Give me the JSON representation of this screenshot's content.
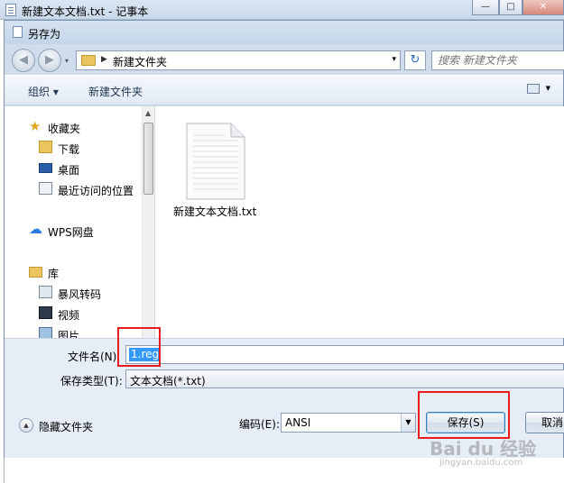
{
  "notepad": {
    "title": "新建文本文档.txt - 记事本",
    "minimize": "—",
    "maximize": "□",
    "close": "✕"
  },
  "dialog": {
    "title": "另存为",
    "nav": {
      "back": "◀",
      "forward": "▶",
      "path_current": "新建文件夹",
      "refresh": "↻",
      "search_placeholder": "搜索 新建文件夹"
    },
    "toolbar": {
      "organize": "组织 ▾",
      "new_folder": "新建文件夹"
    },
    "sidebar": {
      "favorites": "收藏夹",
      "items": [
        {
          "label": "下载",
          "icon": "download-folder-icon"
        },
        {
          "label": "桌面",
          "icon": "desktop-icon"
        },
        {
          "label": "最近访问的位置",
          "icon": "recent-places-icon"
        }
      ],
      "wps": "WPS网盘",
      "libraries": "库",
      "library_items": [
        {
          "label": "暴风转码",
          "icon": "video-library-icon"
        },
        {
          "label": "视频",
          "icon": "video-icon"
        },
        {
          "label": "图片",
          "icon": "pictures-icon"
        }
      ]
    },
    "files": [
      {
        "name": "新建文本文档.txt",
        "icon": "text-file-icon"
      }
    ],
    "form": {
      "filename_label": "文件名(N):",
      "filename_value": "1.reg",
      "filetype_label": "保存类型(T):",
      "filetype_value": "文本文档(*.txt)",
      "hide_folders": "隐藏文件夹",
      "encoding_label": "编码(E):",
      "encoding_value": "ANSI",
      "save_button": "保存(S)",
      "cancel_button": "取消"
    }
  },
  "watermark": {
    "brand": "Bai du 经验",
    "url": "jingyan.baidu.com"
  },
  "colors": {
    "annotation_red": "#e81c1c",
    "selection_blue": "#3399ff"
  }
}
